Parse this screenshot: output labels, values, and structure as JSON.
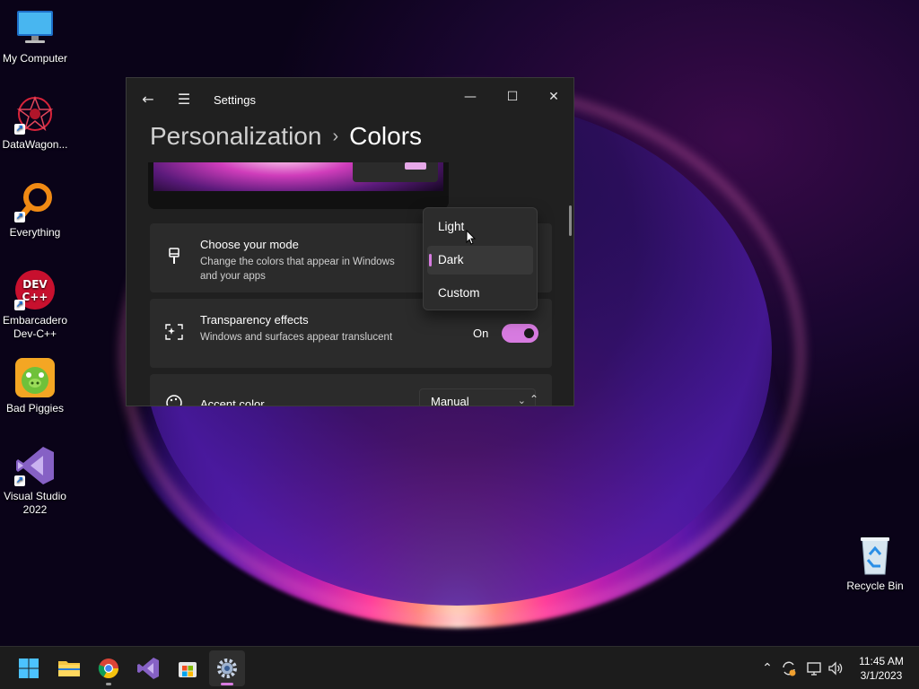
{
  "desktop": {
    "icons": [
      {
        "label": "My Computer",
        "icon": "computer-icon"
      },
      {
        "label": "DataWagon...",
        "icon": "datawagon-icon"
      },
      {
        "label": "Everything",
        "icon": "everything-search-icon"
      },
      {
        "label": "Embarcadero Dev-C++",
        "icon": "devcpp-icon",
        "badge": "DEV C++"
      },
      {
        "label": "Bad Piggies",
        "icon": "bad-piggies-icon"
      },
      {
        "label": "Visual Studio 2022",
        "icon": "visual-studio-icon"
      },
      {
        "label": "Recycle Bin",
        "icon": "recycle-bin-icon"
      }
    ]
  },
  "window": {
    "app_title": "Settings",
    "breadcrumb": {
      "parent": "Personalization",
      "separator": "›",
      "current": "Colors"
    },
    "cards": {
      "mode": {
        "title": "Choose your mode",
        "description": "Change the colors that appear in Windows and your apps",
        "icon": "paintbrush-icon"
      },
      "transparency": {
        "title": "Transparency effects",
        "description": "Windows and surfaces appear translucent",
        "icon": "transparency-sparkle-icon",
        "toggle_label": "On",
        "toggle_state": true
      },
      "accent": {
        "title": "Accent color",
        "icon": "palette-icon",
        "select_value": "Manual"
      }
    },
    "mode_dropdown": {
      "options": [
        "Light",
        "Dark",
        "Custom"
      ],
      "selected": "Dark"
    }
  },
  "taskbar": {
    "apps": [
      {
        "name": "start",
        "icon": "windows-start-icon"
      },
      {
        "name": "file-explorer",
        "icon": "folder-icon"
      },
      {
        "name": "chrome",
        "icon": "chrome-icon"
      },
      {
        "name": "visual-studio",
        "icon": "visual-studio-icon"
      },
      {
        "name": "store",
        "icon": "store-icon"
      },
      {
        "name": "settings",
        "icon": "gear-icon",
        "active": true
      }
    ],
    "tray": {
      "time": "11:45 AM",
      "date": "3/1/2023"
    }
  },
  "colors": {
    "accent": "#d77be0",
    "window_bg": "#202020",
    "card_bg": "#2b2b2b",
    "taskbar_bg": "#1c1c1c"
  }
}
